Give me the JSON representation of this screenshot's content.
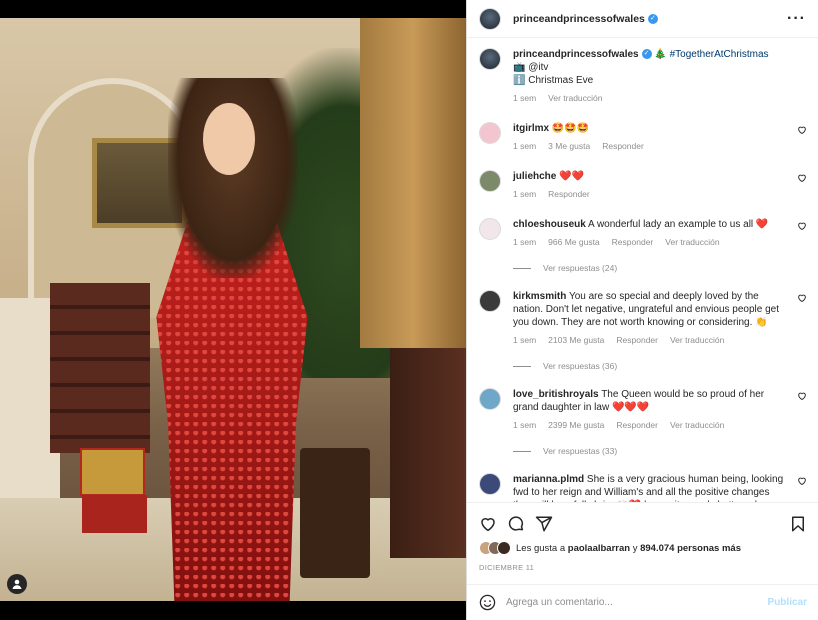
{
  "post": {
    "username": "princeandprincessofwales",
    "more_icon": "ellipsis-icon"
  },
  "caption": {
    "username": "princeandprincessofwales",
    "line1_rest": "🎄 #TogetherAtChristmas",
    "line2": "📺 @itv",
    "line3": "ℹ️ Christmas Eve",
    "time": "1 sem",
    "translate": "Ver traducción"
  },
  "comments": [
    {
      "username": "itgirlmx",
      "text": "🤩🤩🤩",
      "time": "1 sem",
      "likes": "3 Me gusta",
      "reply": "Responder",
      "translate": "",
      "replies": "",
      "avatar_color": "#f3c6cf"
    },
    {
      "username": "juliehche",
      "text": "❤️❤️",
      "time": "1 sem",
      "likes": "",
      "reply": "Responder",
      "translate": "",
      "replies": "",
      "avatar_color": "#7d8a6a"
    },
    {
      "username": "chloeshouseuk",
      "text": "A wonderful lady an example to us all ❤️",
      "time": "1 sem",
      "likes": "966 Me gusta",
      "reply": "Responder",
      "translate": "Ver traducción",
      "replies": "Ver respuestas (24)",
      "avatar_color": "#f1e6ea"
    },
    {
      "username": "kirkmsmith",
      "text": "You are so special and deeply loved by the nation. Don't let negative, ungrateful and envious people get you down. They are not worth knowing or considering. 👏",
      "time": "1 sem",
      "likes": "2103 Me gusta",
      "reply": "Responder",
      "translate": "Ver traducción",
      "replies": "Ver respuestas (36)",
      "avatar_color": "#3a3a3a"
    },
    {
      "username": "love_britishroyals",
      "text": "The Queen would be so proud of her grand daughter in law ❤️❤️❤️",
      "time": "1 sem",
      "likes": "2399 Me gusta",
      "reply": "Responder",
      "translate": "Ver traducción",
      "replies": "Ver respuestas (33)",
      "avatar_color": "#6fa7c9"
    },
    {
      "username": "marianna.plmd",
      "text": "She is a very gracious human being, looking fwd to her reign and William's and all the positive changes they will hopefully bring🙌❤️ humanity needs better role models",
      "time": "",
      "likes": "",
      "reply": "",
      "translate": "",
      "replies": "",
      "avatar_color": "#3c4a7a"
    }
  ],
  "actions": {
    "like_icon": "heart-icon",
    "comment_icon": "comment-icon",
    "share_icon": "send-icon",
    "save_icon": "bookmark-icon"
  },
  "likes": {
    "prefix": "Les gusta a",
    "user": "paolaalbarran",
    "mid": "y",
    "count": "894.074 personas más"
  },
  "date": "DICIEMBRE 11",
  "add_comment": {
    "placeholder": "Agrega un comentario...",
    "post": "Publicar",
    "emoji_icon": "emoji-icon"
  },
  "colors": {
    "verified": "#3897f0",
    "link": "#00376b",
    "muted": "#8e8e8e",
    "post_disabled": "#b2dffc"
  }
}
